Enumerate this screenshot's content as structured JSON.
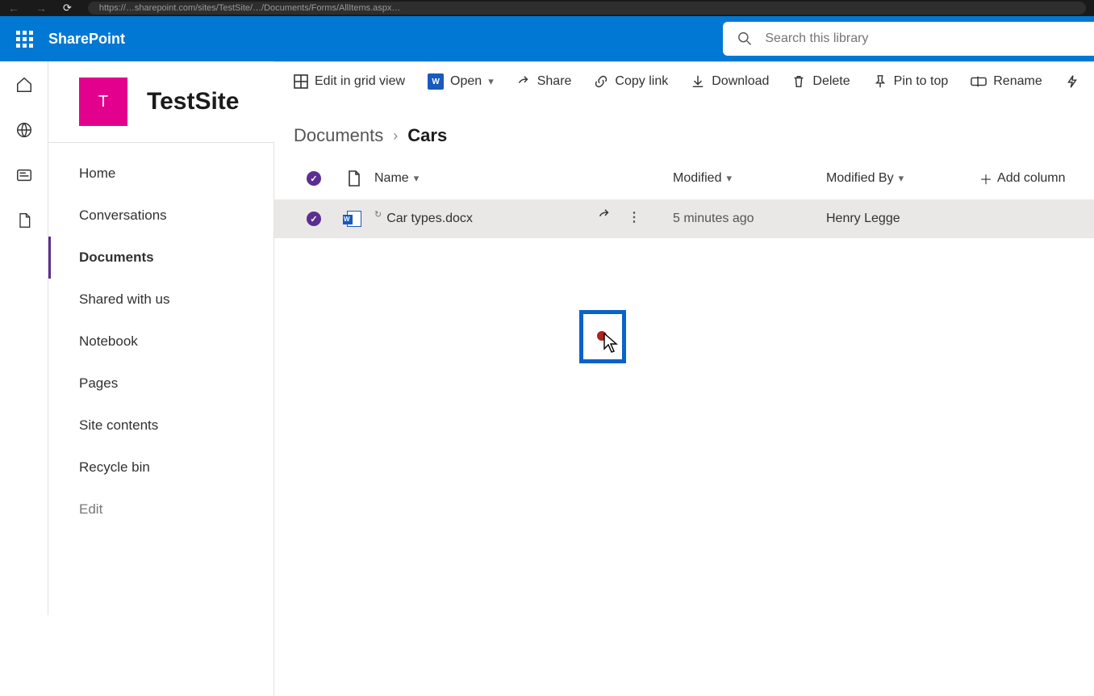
{
  "browser": {
    "url_hint": "https://…sharepoint.com/sites/TestSite/…/Documents/Forms/AllItems.aspx…"
  },
  "suite": {
    "title": "SharePoint",
    "search_placeholder": "Search this library"
  },
  "site": {
    "logo_letter": "T",
    "title": "TestSite"
  },
  "nav": {
    "items": [
      {
        "label": "Home"
      },
      {
        "label": "Conversations"
      },
      {
        "label": "Documents"
      },
      {
        "label": "Shared with us"
      },
      {
        "label": "Notebook"
      },
      {
        "label": "Pages"
      },
      {
        "label": "Site contents"
      },
      {
        "label": "Recycle bin"
      }
    ],
    "edit_label": "Edit",
    "active_index": 2
  },
  "commands": {
    "edit_grid": "Edit in grid view",
    "open": "Open",
    "share": "Share",
    "copy_link": "Copy link",
    "download": "Download",
    "delete": "Delete",
    "pin": "Pin to top",
    "rename": "Rename"
  },
  "breadcrumb": {
    "root": "Documents",
    "current": "Cars"
  },
  "columns": {
    "name": "Name",
    "modified": "Modified",
    "modified_by": "Modified By",
    "add": "Add column"
  },
  "rows": [
    {
      "name": "Car types.docx",
      "modified": "5 minutes ago",
      "modified_by": "Henry Legge",
      "selected": true
    }
  ],
  "colors": {
    "brand": "#0078d4",
    "site_accent": "#e3008c",
    "selection": "#5b2e91"
  }
}
